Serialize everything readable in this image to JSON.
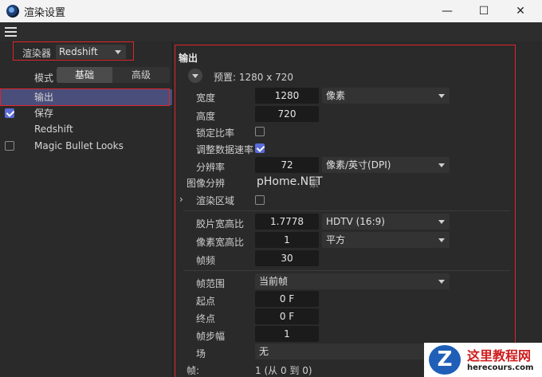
{
  "window": {
    "title": "渲染设置",
    "minimize": "—",
    "maximize": "☐",
    "close": "✕"
  },
  "renderer": {
    "label": "渲染器",
    "value": "Redshift"
  },
  "mode": {
    "label": "模式",
    "tabs": [
      "基础",
      "高级"
    ],
    "active": 0
  },
  "tree": [
    {
      "label": "输出",
      "checkbox": false,
      "selected": true
    },
    {
      "label": "保存",
      "checkbox": true,
      "checked": true
    },
    {
      "label": "Redshift",
      "checkbox": false
    },
    {
      "label": "Magic Bullet Looks",
      "checkbox": true,
      "checked": false
    }
  ],
  "output": {
    "title": "输出",
    "preset": "预置: 1280 x 720",
    "width": {
      "label": "宽度",
      "value": "1280",
      "unit": "像素"
    },
    "height": {
      "label": "高度",
      "value": "720"
    },
    "lock_ratio": {
      "label": "锁定比率",
      "checked": false
    },
    "adjust_rate": {
      "label": "调整数据速率",
      "checked": true
    },
    "resolution": {
      "label": "分辨率",
      "value": "72",
      "unit": "像素/英寸(DPI)"
    },
    "image_res_label": "图像分辨",
    "image_res_suffix": "素",
    "render_region": {
      "label": "渲染区域",
      "checked": false
    },
    "film_aspect": {
      "label": "胶片宽高比",
      "value": "1.7778",
      "option": "HDTV (16:9)"
    },
    "pixel_aspect": {
      "label": "像素宽高比",
      "value": "1",
      "option": "平方"
    },
    "fps": {
      "label": "帧频",
      "value": "30"
    },
    "frame_range": {
      "label": "帧范围",
      "value": "当前帧"
    },
    "start": {
      "label": "起点",
      "value": "0 F"
    },
    "end": {
      "label": "终点",
      "value": "0 F"
    },
    "step": {
      "label": "帧步幅",
      "value": "1"
    },
    "field": {
      "label": "场",
      "value": "无"
    },
    "frames": {
      "label": "帧:",
      "value": "1 (从 0 到 0)"
    }
  },
  "watermark": {
    "text": "pHome.NET",
    "logo_title": "这里教程网",
    "logo_url": "herecours.com",
    "logo_mark": "Z"
  },
  "colors": {
    "accent": "#5a6bd8",
    "selection": "#4a4e7a",
    "highlight_frame": "#e0242a"
  }
}
